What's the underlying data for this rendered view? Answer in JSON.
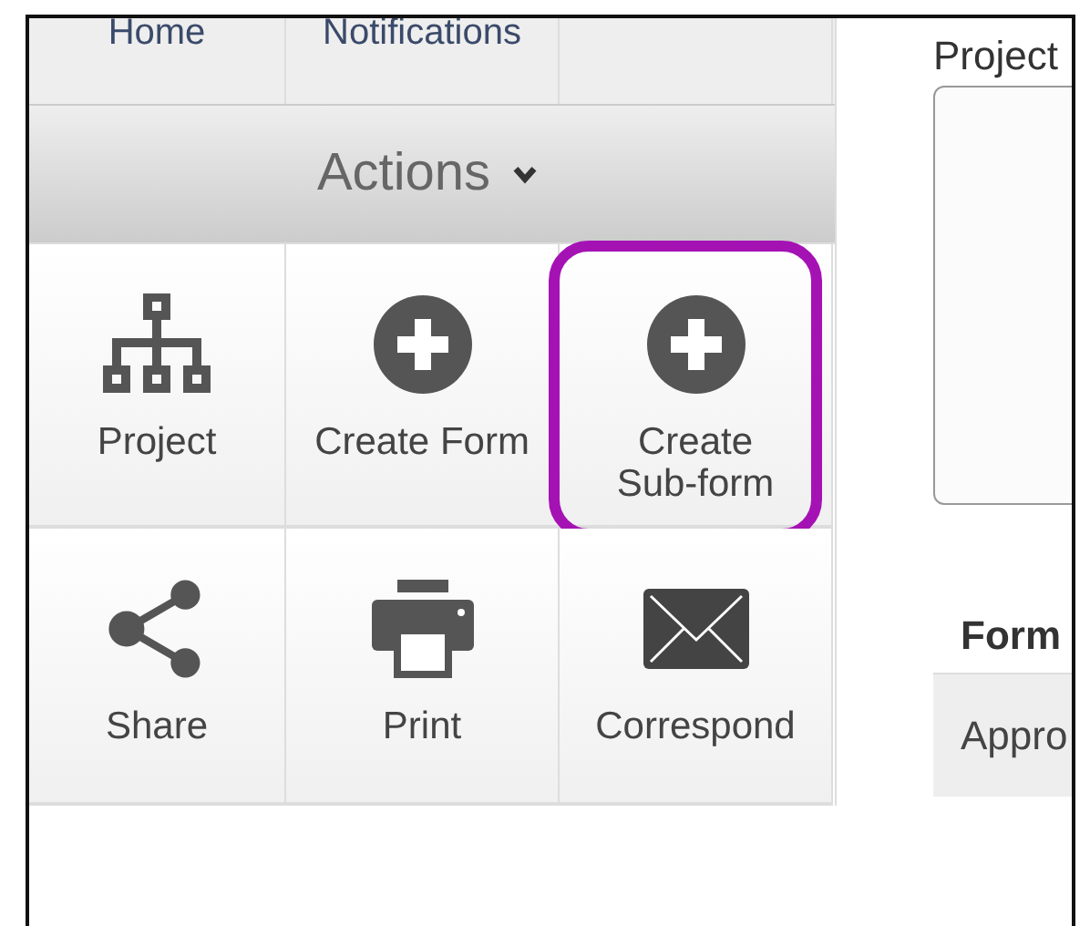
{
  "nav_tabs": [
    {
      "label": "Home"
    },
    {
      "label": "Notifications"
    }
  ],
  "actions_menu": {
    "title": "Actions",
    "expanded": true
  },
  "actions": [
    {
      "kind": "project",
      "label": "Project",
      "highlighted": false
    },
    {
      "kind": "create",
      "label": "Create Form",
      "highlighted": false
    },
    {
      "kind": "create",
      "label": "Create Sub-form",
      "highlighted": true
    },
    {
      "kind": "share",
      "label": "Share",
      "highlighted": false
    },
    {
      "kind": "print",
      "label": "Print",
      "highlighted": false
    },
    {
      "kind": "mail",
      "label": "Correspond",
      "highlighted": false
    }
  ],
  "project_field": {
    "label": "Project"
  },
  "table": {
    "columns": [
      "Form"
    ],
    "rows": [
      [
        "Appro"
      ]
    ]
  }
}
